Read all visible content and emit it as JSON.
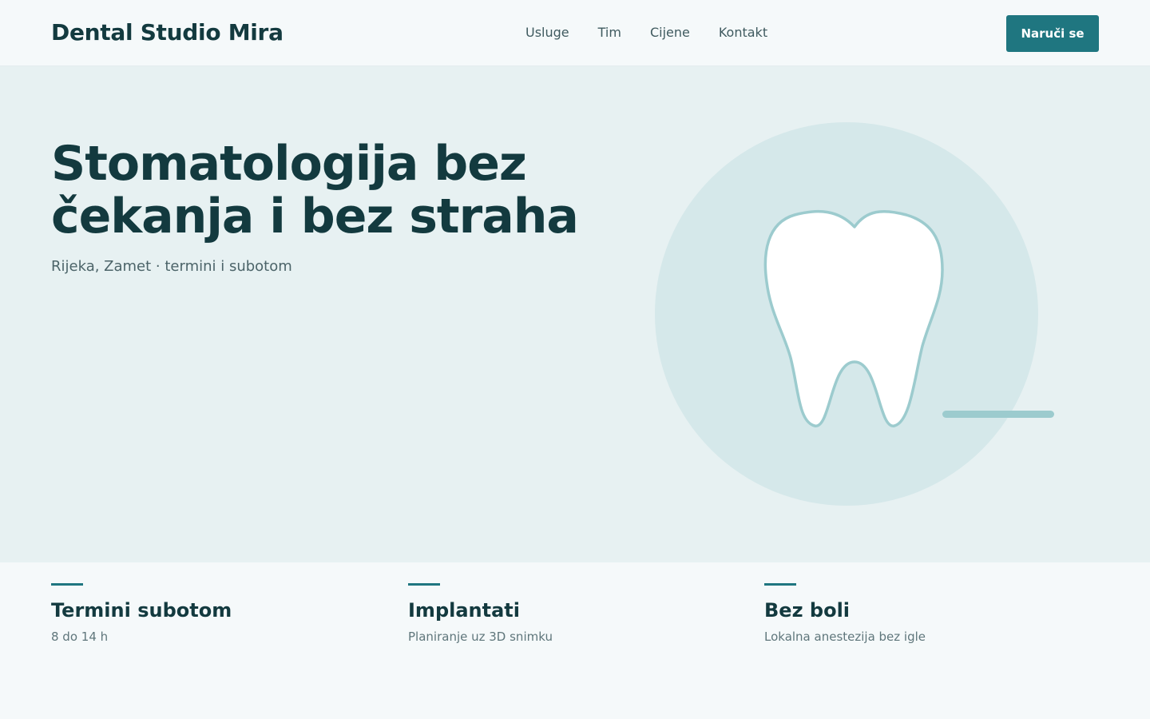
{
  "header": {
    "brand": "Dental Studio Mira",
    "nav": [
      "Usluge",
      "Tim",
      "Cijene",
      "Kontakt"
    ],
    "cta_label": "Naruči se"
  },
  "hero": {
    "title": "Stomatologija bez čekanja i bez straha",
    "subtitle": "Rijeka, Zamet · termini i subotom",
    "illustration": "tooth-icon"
  },
  "features": [
    {
      "title": "Termini subotom",
      "description": "8 do 14 h"
    },
    {
      "title": "Implantati",
      "description": "Planiranje uz 3D snimku"
    },
    {
      "title": "Bez boli",
      "description": "Lokalna anestezija bez igle"
    }
  ],
  "colors": {
    "accent": "#1f7680",
    "heading": "#133a3f",
    "hero_background": "#e7f1f2",
    "circle": "#d5e8ea",
    "tooth_outline": "#9ccbce"
  }
}
